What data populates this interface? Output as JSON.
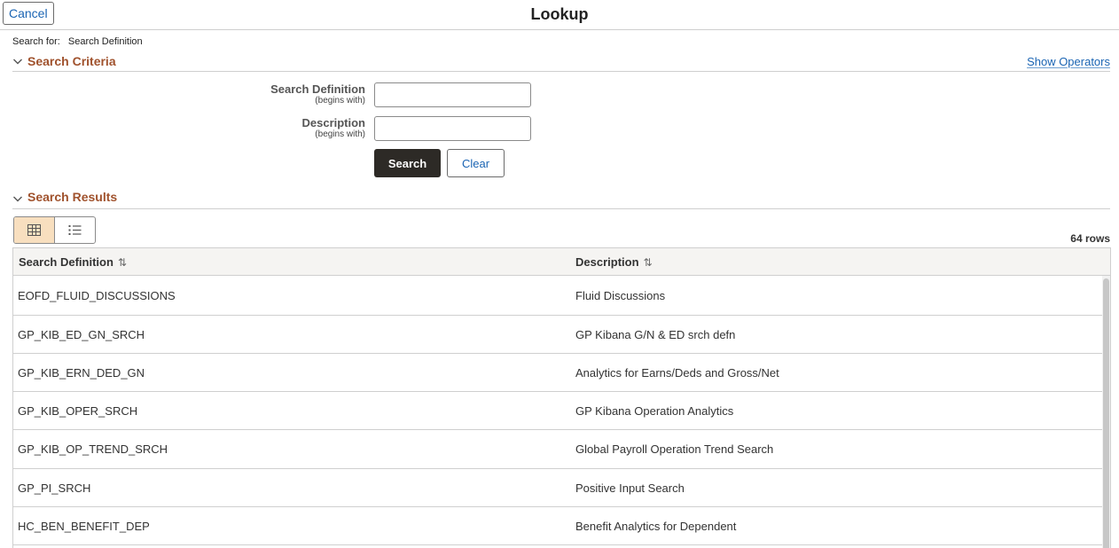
{
  "header": {
    "cancel_label": "Cancel",
    "title": "Lookup"
  },
  "search_for": {
    "label": "Search for:",
    "value": "Search Definition"
  },
  "criteria": {
    "title": "Search Criteria",
    "show_operators": "Show Operators",
    "fields": [
      {
        "label": "Search Definition",
        "qualifier": "(begins with)",
        "value": ""
      },
      {
        "label": "Description",
        "qualifier": "(begins with)",
        "value": ""
      }
    ],
    "search_label": "Search",
    "clear_label": "Clear"
  },
  "results": {
    "title": "Search Results",
    "row_count": "64 rows",
    "columns": [
      "Search Definition",
      "Description"
    ],
    "sort_glyph": "⇅",
    "rows": [
      [
        "EOFD_FLUID_DISCUSSIONS",
        "Fluid Discussions"
      ],
      [
        "GP_KIB_ED_GN_SRCH",
        "GP Kibana G/N & ED srch defn"
      ],
      [
        "GP_KIB_ERN_DED_GN",
        "Analytics for Earns/Deds and Gross/Net"
      ],
      [
        "GP_KIB_OPER_SRCH",
        "GP Kibana Operation Analytics"
      ],
      [
        "GP_KIB_OP_TREND_SRCH",
        "Global Payroll Operation Trend Search"
      ],
      [
        "GP_PI_SRCH",
        "Positive Input Search"
      ],
      [
        "HC_BEN_BENEFIT_DEP",
        "Benefit Analytics for Dependent"
      ]
    ]
  },
  "colors": {
    "section_title": "#a0522d",
    "link": "#1a64b3",
    "primary_button": "#2d2a26",
    "toggle_active": "#f8dfbf"
  },
  "icons": {
    "section_chevron": "chevron-down-icon",
    "grid_view": "grid-view-icon",
    "list_view": "list-view-icon",
    "sort": "sort-icon"
  }
}
